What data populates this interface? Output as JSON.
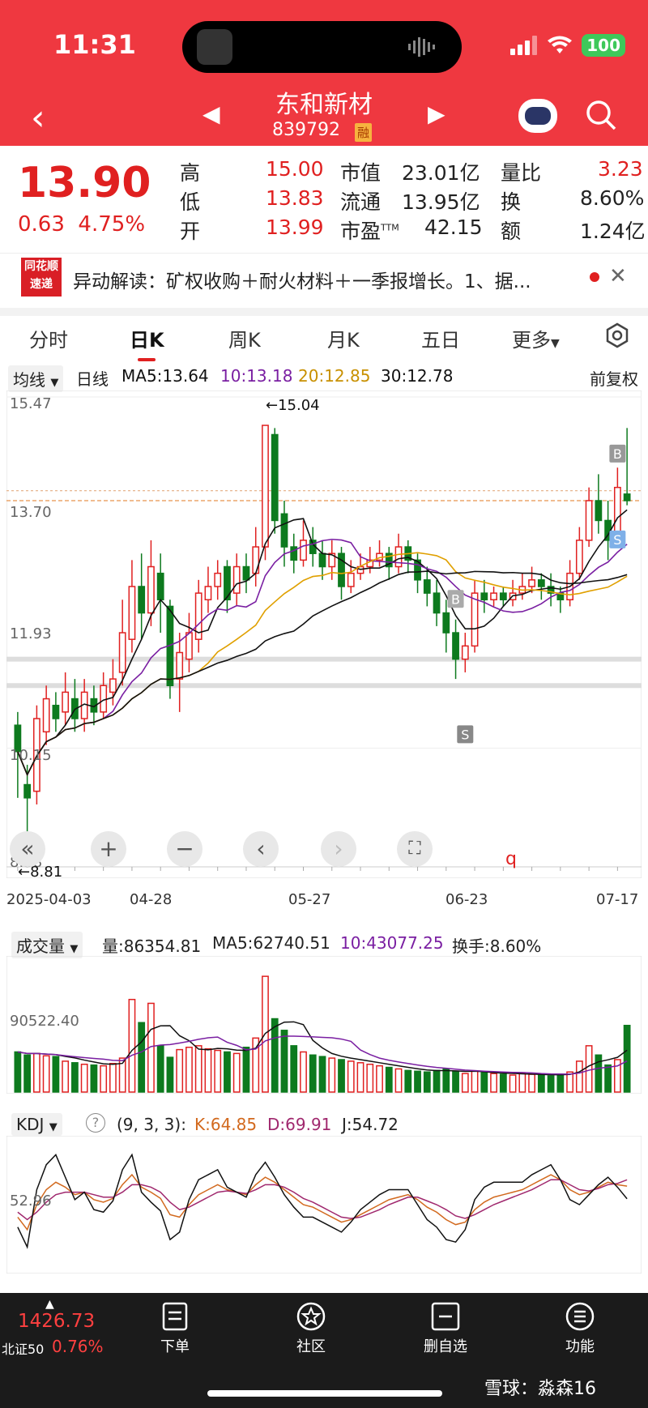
{
  "status": {
    "time": "11:31",
    "battery": "100"
  },
  "header": {
    "name": "东和新材",
    "code": "839792",
    "badge": "融"
  },
  "quote": {
    "price": "13.90",
    "change": "0.63",
    "change_pct": "4.75%",
    "rows": [
      {
        "l1": "高",
        "v1": "15.00",
        "l2": "市值",
        "v2": "23.01亿",
        "l3": "量比",
        "v3": "3.23"
      },
      {
        "l1": "低",
        "v1": "13.83",
        "l2": "流通",
        "v2": "13.95亿",
        "l3": "换",
        "v3": "8.60%"
      },
      {
        "l1": "开",
        "v1": "13.99",
        "l2": "市盈",
        "l2sup": "TTM",
        "v2": "42.15",
        "l3": "额",
        "v3": "1.24亿"
      }
    ]
  },
  "news": {
    "logo_top": "同花顺",
    "logo_bottom": "速递",
    "text": "异动解读：矿权收购＋耐火材料＋一季报增长。1、据..."
  },
  "tabs": [
    "分时",
    "日K",
    "周K",
    "月K",
    "五日",
    "更多"
  ],
  "kline": {
    "ma_chip": "均线",
    "period": "日线",
    "ma5": "MA5:13.64",
    "ma10": "10:13.18",
    "ma20": "20:12.85",
    "ma30": "30:12.78",
    "adjust": "前复权",
    "y_labels": [
      "15.47",
      "13.70",
      "11.93",
      "10.15",
      "8.38"
    ],
    "high_mark": "←15.04",
    "low_mark": "←8.81",
    "dates": [
      "2025-04-03",
      "04-28",
      "05-27",
      "06-23",
      "07-17"
    ],
    "marker_b": "B",
    "marker_s": "S",
    "marker_q": "q"
  },
  "volume": {
    "chip": "成交量",
    "amount": "量:86354.81",
    "ma5": "MA5:62740.51",
    "ma10": "10:43077.25",
    "turnover": "换手:8.60%",
    "y_label": "90522.40"
  },
  "kdj": {
    "chip": "KDJ",
    "help": "?",
    "params": "(9, 3, 3):",
    "k": "K:64.85",
    "d": "D:69.91",
    "j": "J:54.72",
    "y_label": "52.96"
  },
  "bottom": {
    "index_value": "1426.73",
    "index_name": "北证50",
    "index_pct": "0.76%",
    "nav": [
      "下单",
      "社区",
      "删自选",
      "功能"
    ],
    "watermark": "雪球：淼森16"
  },
  "colors": {
    "up": "#e02020",
    "down": "#0d7a1e",
    "header": "#ef3840",
    "ma5": "#111111",
    "ma10": "#7a1fa2",
    "ma20": "#e0a000",
    "ma30": "#111111"
  },
  "chart_data": {
    "type": "candlestick",
    "ylim": [
      8.38,
      15.47
    ],
    "candles": [
      [
        10.5,
        10.1,
        10.7,
        9.4
      ],
      [
        9.6,
        9.4,
        9.9,
        8.81
      ],
      [
        9.5,
        10.6,
        10.8,
        9.3
      ],
      [
        10.4,
        10.9,
        11.1,
        10.2
      ],
      [
        10.8,
        10.6,
        11.0,
        10.4
      ],
      [
        10.7,
        11.0,
        11.3,
        10.5
      ],
      [
        10.9,
        10.6,
        11.2,
        10.4
      ],
      [
        10.6,
        11.0,
        11.2,
        10.4
      ],
      [
        10.9,
        10.7,
        11.1,
        10.5
      ],
      [
        10.7,
        11.1,
        11.3,
        10.6
      ],
      [
        11.0,
        11.2,
        11.5,
        10.8
      ],
      [
        11.3,
        11.9,
        12.4,
        11.1
      ],
      [
        11.8,
        12.6,
        13.0,
        11.6
      ],
      [
        12.6,
        12.2,
        13.1,
        11.8
      ],
      [
        12.2,
        12.9,
        13.3,
        12.0
      ],
      [
        12.8,
        12.4,
        13.1,
        11.9
      ],
      [
        12.3,
        11.1,
        12.4,
        10.9
      ],
      [
        11.2,
        11.6,
        11.9,
        10.7
      ],
      [
        11.5,
        11.9,
        12.2,
        11.3
      ],
      [
        11.8,
        12.5,
        12.7,
        11.6
      ],
      [
        12.4,
        12.6,
        12.9,
        12.2
      ],
      [
        12.6,
        12.8,
        13.0,
        12.4
      ],
      [
        12.9,
        12.4,
        13.0,
        12.2
      ],
      [
        12.5,
        12.9,
        13.1,
        12.3
      ],
      [
        12.9,
        12.7,
        13.1,
        12.5
      ],
      [
        12.8,
        13.2,
        13.5,
        12.6
      ],
      [
        13.2,
        15.04,
        15.04,
        13.0
      ],
      [
        14.9,
        13.6,
        15.0,
        13.4
      ],
      [
        13.7,
        13.2,
        13.9,
        12.9
      ],
      [
        13.2,
        13.0,
        13.4,
        12.8
      ],
      [
        13.0,
        13.3,
        13.6,
        12.9
      ],
      [
        13.3,
        13.1,
        13.5,
        12.9
      ],
      [
        13.1,
        12.9,
        13.3,
        12.7
      ],
      [
        12.9,
        13.1,
        13.3,
        12.7
      ],
      [
        13.1,
        12.6,
        13.2,
        12.4
      ],
      [
        12.6,
        12.8,
        13.0,
        12.5
      ],
      [
        12.8,
        12.9,
        13.1,
        12.7
      ],
      [
        12.9,
        13.0,
        13.2,
        12.8
      ],
      [
        13.0,
        13.1,
        13.3,
        12.9
      ],
      [
        13.1,
        12.9,
        13.2,
        12.7
      ],
      [
        12.9,
        13.2,
        13.4,
        12.8
      ],
      [
        13.2,
        13.0,
        13.3,
        12.8
      ],
      [
        13.0,
        12.7,
        13.1,
        12.5
      ],
      [
        12.7,
        12.5,
        12.9,
        12.3
      ],
      [
        12.5,
        12.2,
        12.7,
        12.0
      ],
      [
        12.2,
        11.9,
        12.4,
        11.6
      ],
      [
        11.9,
        11.5,
        12.1,
        11.2
      ],
      [
        11.5,
        11.7,
        11.9,
        11.3
      ],
      [
        11.7,
        12.5,
        12.7,
        11.6
      ],
      [
        12.5,
        12.4,
        12.7,
        12.2
      ],
      [
        12.4,
        12.5,
        12.6,
        12.3
      ],
      [
        12.5,
        12.4,
        12.6,
        12.3
      ],
      [
        12.4,
        12.5,
        12.7,
        12.3
      ],
      [
        12.5,
        12.6,
        12.8,
        12.4
      ],
      [
        12.6,
        12.7,
        12.9,
        12.5
      ],
      [
        12.7,
        12.6,
        12.8,
        12.4
      ],
      [
        12.6,
        12.5,
        12.8,
        12.3
      ],
      [
        12.5,
        12.4,
        12.6,
        12.2
      ],
      [
        12.4,
        12.8,
        13.0,
        12.3
      ],
      [
        12.8,
        13.3,
        13.5,
        12.7
      ],
      [
        13.3,
        13.9,
        14.1,
        13.2
      ],
      [
        13.9,
        13.6,
        14.3,
        13.4
      ],
      [
        13.6,
        13.3,
        13.9,
        13.0
      ],
      [
        13.3,
        14.1,
        14.4,
        13.2
      ],
      [
        14.0,
        13.9,
        15.0,
        13.83
      ]
    ],
    "volume": [
      52000,
      48000,
      50000,
      47000,
      46000,
      40000,
      38000,
      36000,
      35000,
      34000,
      37000,
      44000,
      120000,
      90000,
      115000,
      60000,
      45000,
      55000,
      58000,
      60000,
      56000,
      54000,
      52000,
      50000,
      58000,
      70000,
      150000,
      95000,
      80000,
      60000,
      52000,
      48000,
      46000,
      44000,
      42000,
      40000,
      38000,
      36000,
      34000,
      32000,
      30000,
      28000,
      27000,
      26000,
      28000,
      30000,
      26000,
      24000,
      27000,
      25000,
      24000,
      23000,
      22000,
      24000,
      23000,
      22000,
      21000,
      22000,
      26000,
      40000,
      60000,
      48000,
      35000,
      42000,
      86354.81
    ],
    "kdj_k": [
      40,
      30,
      50,
      62,
      68,
      64,
      58,
      60,
      54,
      52,
      55,
      66,
      74,
      64,
      60,
      55,
      42,
      40,
      50,
      58,
      62,
      66,
      62,
      60,
      58,
      66,
      72,
      68,
      62,
      56,
      50,
      48,
      44,
      40,
      36,
      38,
      42,
      46,
      50,
      54,
      56,
      58,
      54,
      48,
      44,
      38,
      34,
      36,
      46,
      52,
      56,
      58,
      60,
      62,
      66,
      70,
      74,
      70,
      62,
      58,
      60,
      64,
      68,
      66,
      64.85
    ],
    "kdj_d": [
      44,
      38,
      44,
      52,
      58,
      60,
      60,
      60,
      58,
      56,
      56,
      60,
      66,
      66,
      64,
      60,
      52,
      46,
      48,
      52,
      56,
      60,
      61,
      60,
      59,
      62,
      66,
      66,
      64,
      60,
      55,
      52,
      48,
      44,
      40,
      39,
      40,
      43,
      46,
      50,
      53,
      56,
      56,
      53,
      50,
      46,
      41,
      39,
      42,
      46,
      50,
      53,
      56,
      59,
      62,
      66,
      70,
      70,
      66,
      62,
      61,
      63,
      66,
      67,
      69.91
    ],
    "kdj_j": [
      32,
      16,
      62,
      82,
      90,
      72,
      54,
      60,
      46,
      44,
      53,
      78,
      90,
      60,
      52,
      45,
      22,
      28,
      54,
      70,
      74,
      78,
      64,
      60,
      56,
      74,
      84,
      72,
      58,
      48,
      40,
      40,
      36,
      32,
      28,
      36,
      46,
      52,
      58,
      62,
      62,
      62,
      50,
      38,
      32,
      22,
      20,
      30,
      54,
      64,
      68,
      68,
      68,
      68,
      74,
      78,
      82,
      70,
      54,
      50,
      58,
      66,
      72,
      64,
      54.72
    ]
  }
}
